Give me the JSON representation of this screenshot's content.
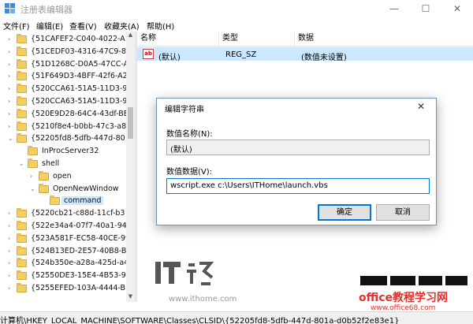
{
  "window": {
    "title": "注册表编辑器",
    "minimize": "—",
    "maximize": "☐",
    "close": "✕"
  },
  "menu": [
    "文件(F)",
    "编辑(E)",
    "查看(V)",
    "收藏夹(A)",
    "帮助(H)"
  ],
  "tree": [
    {
      "label": "{51CAFEF2-C040-4022-A1",
      "expanded": false
    },
    {
      "label": "{51CEDF03-4316-47C9-81",
      "expanded": false
    },
    {
      "label": "{51D1268C-D0A5-47CC-A",
      "expanded": false
    },
    {
      "label": "{51F649D3-4BFF-42f6-A2",
      "expanded": false
    },
    {
      "label": "{520CCA61-51A5-11D3-9",
      "expanded": false
    },
    {
      "label": "{520CCA63-51A5-11D3-9",
      "expanded": false
    },
    {
      "label": "{520E9D28-64C4-43df-BE",
      "expanded": false
    },
    {
      "label": "{5210f8e4-b0bb-47c3-a8",
      "expanded": false
    },
    {
      "label": "{52205fd8-5dfb-447d-80",
      "expanded": true
    },
    {
      "label": "InProcServer32",
      "expanded": false
    },
    {
      "label": "shell",
      "expanded": true
    },
    {
      "label": "open",
      "expanded": false
    },
    {
      "label": "OpenNewWindow",
      "expanded": true
    },
    {
      "label": "command",
      "expanded": false
    },
    {
      "label": "{5220cb21-c88d-11cf-b3",
      "expanded": false
    },
    {
      "label": "{522e34a4-07f7-40a1-94c",
      "expanded": false
    },
    {
      "label": "{523A581F-EC58-40CE-99",
      "expanded": false
    },
    {
      "label": "{524B13ED-2E57-40B8-B",
      "expanded": false
    },
    {
      "label": "{524b350e-a28a-425d-a4",
      "expanded": false
    },
    {
      "label": "{52550DE3-15E4-4B53-96",
      "expanded": false
    },
    {
      "label": "{5255EFED-103A-4444-B1",
      "expanded": false
    }
  ],
  "list": {
    "headers": {
      "name": "名称",
      "type": "类型",
      "data": "数据"
    },
    "rows": [
      {
        "name": "(默认)",
        "type": "REG_SZ",
        "data": "(数值未设置)"
      }
    ]
  },
  "dialog": {
    "title": "编辑字符串",
    "name_label": "数值名称(N):",
    "name_value": "(默认)",
    "data_label": "数值数据(V):",
    "data_value": "wscript.exe c:\\Users\\ITHome\\launch.vbs",
    "ok": "确定",
    "cancel": "取消"
  },
  "status": "计算机\\HKEY_LOCAL_MACHINE\\SOFTWARE\\Classes\\CLSID\\{52205fd8-5dfb-447d-801a-d0b52f2e83e1}",
  "watermarks": {
    "ithome_url": "www.ithome.com",
    "office": "office教程学习网",
    "office_url": "www.office68.com"
  }
}
